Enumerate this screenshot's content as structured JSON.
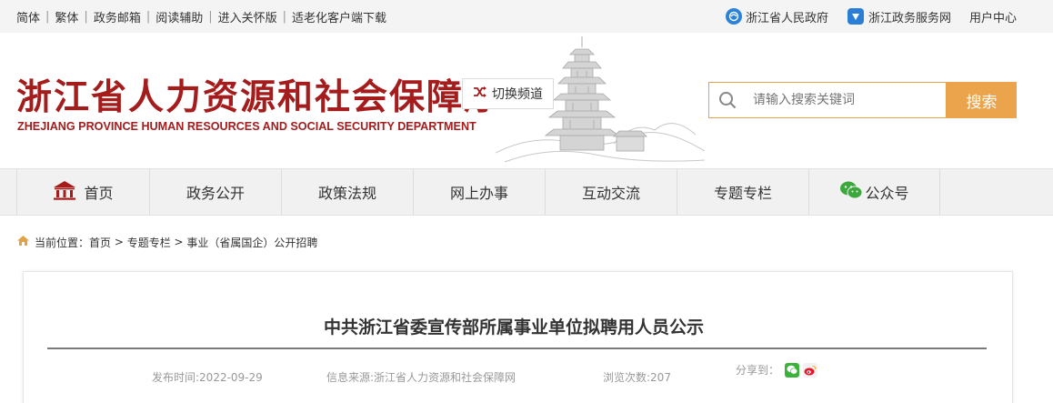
{
  "topbar": {
    "links": [
      "简体",
      "繁体",
      "政务邮箱",
      "阅读辅助",
      "进入关怀版",
      "适老化客户端下载"
    ],
    "gov_link": "浙江省人民政府",
    "service_link": "浙江政务服务网",
    "user_center": "用户中心"
  },
  "header": {
    "title_cn": "浙江省人力资源和社会保障厅",
    "title_en": "ZHEJIANG PROVINCE HUMAN RESOURCES AND SOCIAL SECURITY DEPARTMENT",
    "switch_channel": "切换频道",
    "search_placeholder": "请输入搜索关键词",
    "search_button": "搜索"
  },
  "nav": {
    "items": [
      "首页",
      "政务公开",
      "政策法规",
      "网上办事",
      "互动交流",
      "专题专栏",
      "公众号"
    ]
  },
  "breadcrumb": {
    "label": "当前位置：",
    "path": [
      "首页",
      "专题专栏",
      "事业（省属国企）公开招聘"
    ]
  },
  "article": {
    "title": "中共浙江省委宣传部所属事业单位拟聘用人员公示",
    "publish_time": "发布时间:2022-09-29",
    "source": "信息来源:浙江省人力资源和社会保障网",
    "views": "浏览次数:207",
    "share_label": "分享到："
  },
  "colors": {
    "brand_red": "#a51c1c",
    "accent_orange": "#eba44c",
    "nav_bg": "#f1f1f1"
  }
}
